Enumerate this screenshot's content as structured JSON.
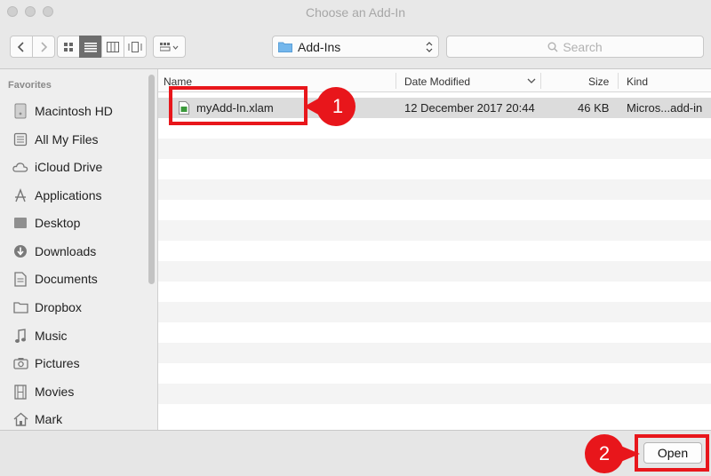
{
  "window": {
    "title": "Choose an Add-In"
  },
  "toolbar": {
    "location": "Add-Ins",
    "search_placeholder": "Search"
  },
  "sidebar": {
    "heading": "Favorites",
    "items": [
      {
        "label": "Macintosh HD",
        "icon": "hard-drive-icon"
      },
      {
        "label": "All My Files",
        "icon": "files-icon"
      },
      {
        "label": "iCloud Drive",
        "icon": "cloud-icon"
      },
      {
        "label": "Applications",
        "icon": "applications-icon"
      },
      {
        "label": "Desktop",
        "icon": "desktop-icon"
      },
      {
        "label": "Downloads",
        "icon": "download-icon"
      },
      {
        "label": "Documents",
        "icon": "document-icon"
      },
      {
        "label": "Dropbox",
        "icon": "folder-icon"
      },
      {
        "label": "Music",
        "icon": "music-icon"
      },
      {
        "label": "Pictures",
        "icon": "camera-icon"
      },
      {
        "label": "Movies",
        "icon": "film-icon"
      },
      {
        "label": "Mark",
        "icon": "home-icon"
      }
    ]
  },
  "columns": {
    "name": "Name",
    "date": "Date Modified",
    "size": "Size",
    "kind": "Kind"
  },
  "files": [
    {
      "name": "myAdd-In.xlam",
      "date": "12 December 2017 20:44",
      "size": "46 KB",
      "kind": "Micros...add-in"
    }
  ],
  "footer": {
    "open_label": "Open"
  },
  "annotations": {
    "step1": "1",
    "step2": "2",
    "color": "#e8161b"
  }
}
